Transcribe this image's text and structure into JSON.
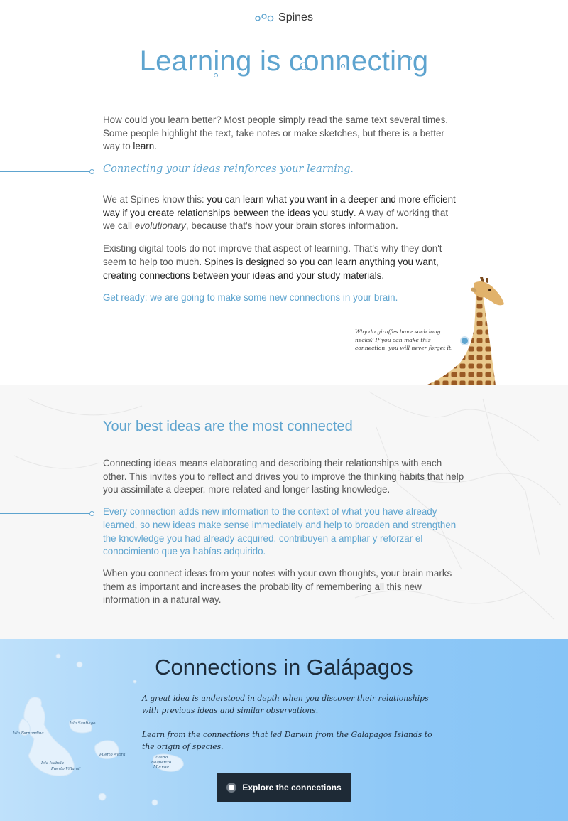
{
  "brand": {
    "name": "Spines",
    "icon": "spines-logo-icon"
  },
  "hero": {
    "title": "Learning is connecting"
  },
  "section1": {
    "intro": "How could you learn better? Most people simply read the same text several times. Some people highlight the text, take notes or make sketches, but there is a better way to ",
    "intro_strong": "learn",
    "intro_end": ".",
    "quote": "Connecting your ideas reinforces your learning.",
    "p2_start": "We at Spines know this: ",
    "p2_strong": "you can learn what you want in a deeper and more efficient way if you create relationships between the ideas you study",
    "p2_mid": ". A way of working that we call ",
    "p2_em": "evolutionary",
    "p2_end": ", because that's how your brain stores information.",
    "p3_start": "Existing digital tools do not improve that aspect of learning. That's why they don't seem to help too much. ",
    "p3_strong": "Spines is designed so you can learn anything you want, creating connections between your ideas and your study materials",
    "p3_end": ".",
    "cta": "Get ready: we are going to make some new connections in your brain.",
    "giraffe_note": "Why do giraffes have such long necks? If you can make this connection, you will never forget it."
  },
  "section2": {
    "title": "Your best ideas are the most connected",
    "p1": "Connecting ideas means elaborating and describing their relationships with each other. This invites you to reflect and drives you to improve the thinking habits that help you assimilate a deeper, more related and longer lasting knowledge.",
    "quote": "Every connection adds new information to the context of what you have already learned, so new ideas make sense immediately and help to broaden and strengthen the knowledge you had already acquired. contribuyen a ampliar y reforzar el conocimiento que ya habías adquirido.",
    "p2": "When you connect ideas from your notes with your own thoughts, your brain marks them as important and increases the probability of remembering all this new information in a natural way."
  },
  "section3": {
    "title": "Connections in Galápagos",
    "p1": "A great idea is understood in depth when you discover their relationships with previous ideas and similar observations.",
    "p2": "Learn from the connections that led Darwin from the Galapagos Islands to the origin of species.",
    "button": "Explore the connections",
    "islands": {
      "fernandina": "Isla Fernandina",
      "santiago": "Isla Santiago",
      "isabela": "Isla Isabela",
      "villamil": "Puerto Villamil",
      "ayora": "Puerto Ayora",
      "baquerizo": "Puerto Baquerizo Moreno"
    }
  },
  "colors": {
    "accent": "#5ea4cf",
    "dark": "#1e2a36",
    "sky": "#8ec8f7"
  }
}
